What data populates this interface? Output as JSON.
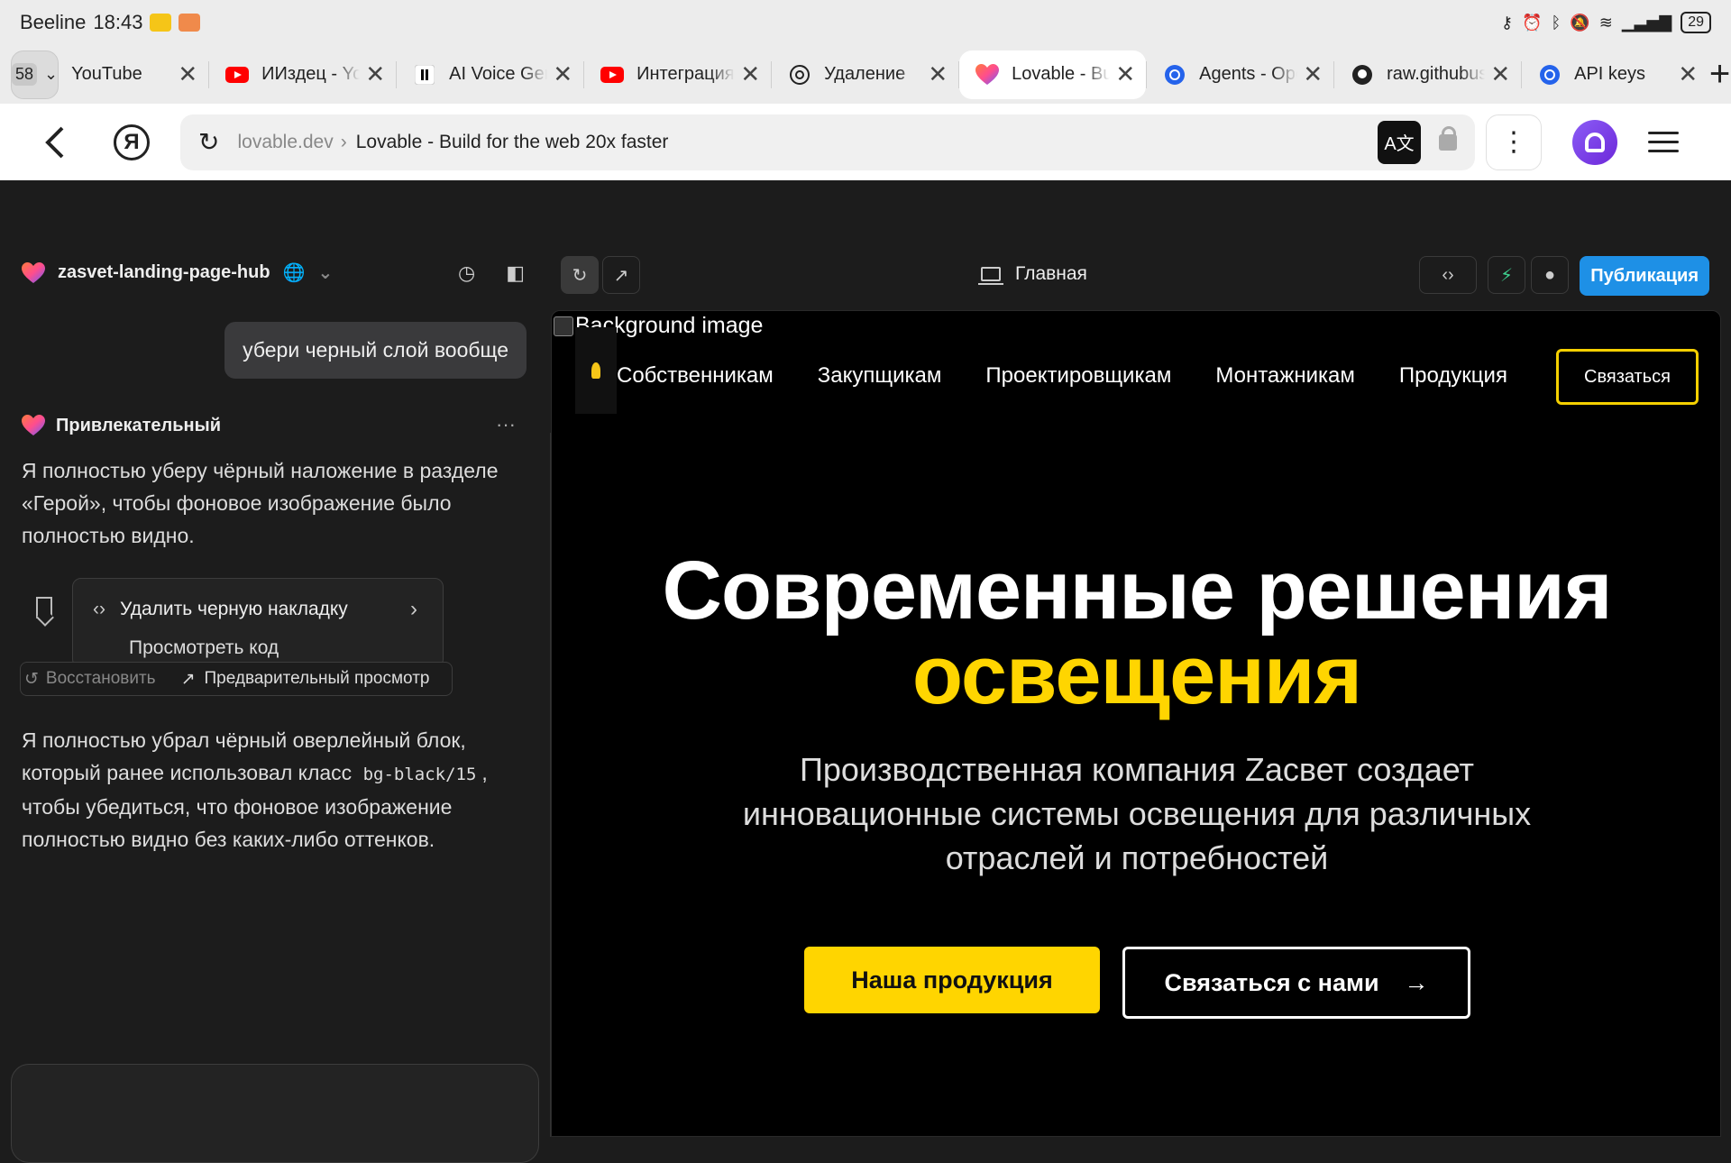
{
  "statusbar": {
    "carrier": "Beeline",
    "time": "18:43",
    "battery": "29"
  },
  "tabs": {
    "count": "58",
    "items": [
      {
        "title": "YouTube",
        "icon": "youtube-icon"
      },
      {
        "title": "ИИздец - YouTube",
        "icon": "youtube-icon"
      },
      {
        "title": "AI Voice Generator",
        "icon": "elevenlabs-icon"
      },
      {
        "title": "Интеграция",
        "icon": "youtube-icon"
      },
      {
        "title": "Удаление",
        "icon": "openai-icon"
      },
      {
        "title": "Lovable - Build",
        "icon": "lovable-heart-icon",
        "active": true
      },
      {
        "title": "Agents - OpenAI",
        "icon": "openai-api-icon"
      },
      {
        "title": "raw.githubusercontent",
        "icon": "github-icon"
      },
      {
        "title": "API keys",
        "icon": "openai-api-icon"
      }
    ],
    "new_tab": "+"
  },
  "address": {
    "domain": "lovable.dev",
    "separator": "›",
    "page_title": "Lovable - Build for the web 20x faster"
  },
  "sidebar": {
    "project_name": "zasvet-landing-page-hub",
    "user_message": "убери черный слой вообще",
    "ai_name": "Привлекательный",
    "ai_more": "···",
    "ai_message_1": "Я полностью уберу чёрный наложение в разделе «Герой», чтобы фоновое изображение было полностью видно.",
    "action_title": "Удалить черную накладку",
    "action_code": "Просмотреть код",
    "restore_label": "Восстановить",
    "preview_label": "Предварительный просмотр",
    "ai_message_2_a": "Я полностью убрал чёрный оверлейный блок, который ранее использовал класс ",
    "ai_message_2_code": "bg-black/15",
    "ai_message_2_b": ", чтобы убедиться, что фоновое изображение полностью видно без каких-либо оттенков."
  },
  "preview_toolbar": {
    "page_label": "Главная",
    "publish_label": "Публикация"
  },
  "site": {
    "bg_alt": "Background image",
    "nav": [
      "Собственникам",
      "Закупщикам",
      "Проектировщикам",
      "Монтажникам",
      "Продукция"
    ],
    "nav_button": "Связаться",
    "hero_line1": "Современные решения",
    "hero_line2": "освещения",
    "subtitle": "Производственная компания Zacвет создает инновационные системы освещения для различных отраслей и потребностей",
    "cta_primary": "Наша продукция",
    "cta_secondary": "Связаться с нами",
    "accent_color": "#ffd500"
  }
}
